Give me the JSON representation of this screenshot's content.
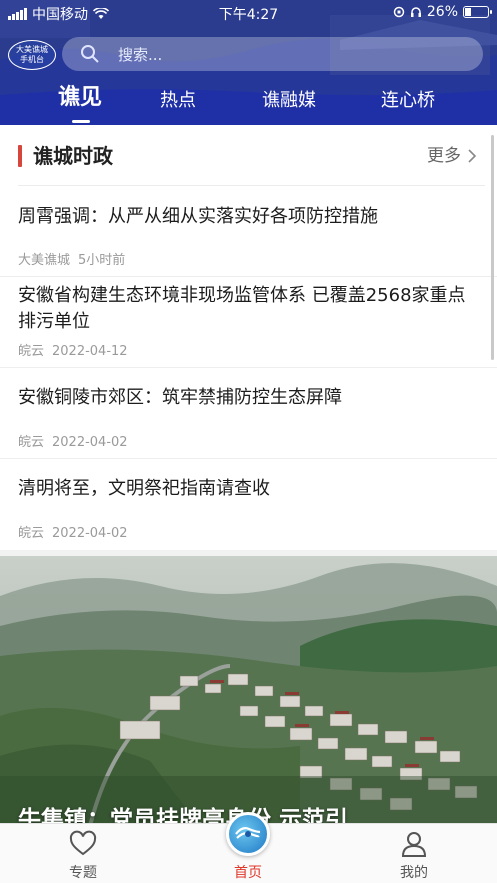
{
  "status_bar": {
    "carrier": "中国移动",
    "time": "下午4:27",
    "battery": "26%",
    "battery_level": 0.26
  },
  "header": {
    "logo_text_line1": "大美谯城",
    "logo_text_line2": "手机台",
    "search_placeholder": "搜索...",
    "tabs": [
      {
        "label": "谯见",
        "active": true
      },
      {
        "label": "热点",
        "active": false
      },
      {
        "label": "谯融媒",
        "active": false
      },
      {
        "label": "连心桥",
        "active": false
      }
    ]
  },
  "section": {
    "title": "谯城时政",
    "more_label": "更多"
  },
  "news": [
    {
      "title": "周霄强调：从严从细从实落实好各项防控措施",
      "source": "大美谯城",
      "time": "5小时前"
    },
    {
      "title": "安徽省构建生态环境非现场监管体系 已覆盖2568家重点排污单位",
      "source": "皖云",
      "time": "2022-04-12"
    },
    {
      "title": "安徽铜陵市郊区：筑牢禁捕防控生态屏障",
      "source": "皖云",
      "time": "2022-04-02"
    },
    {
      "title": "清明将至，文明祭祀指南请查收",
      "source": "皖云",
      "time": "2022-04-02"
    }
  ],
  "banner": {
    "caption": "牛集镇：党员挂牌亮身份 示范引"
  },
  "bottom_nav": [
    {
      "label": "专题",
      "icon": "heart-icon",
      "active": false
    },
    {
      "label": "首页",
      "icon": "home-logo-icon",
      "active": true
    },
    {
      "label": "我的",
      "icon": "person-icon",
      "active": false
    }
  ],
  "colors": {
    "header_blue": "#2a3a93",
    "accent_red": "#d6463a",
    "active_nav": "#e0372b"
  }
}
